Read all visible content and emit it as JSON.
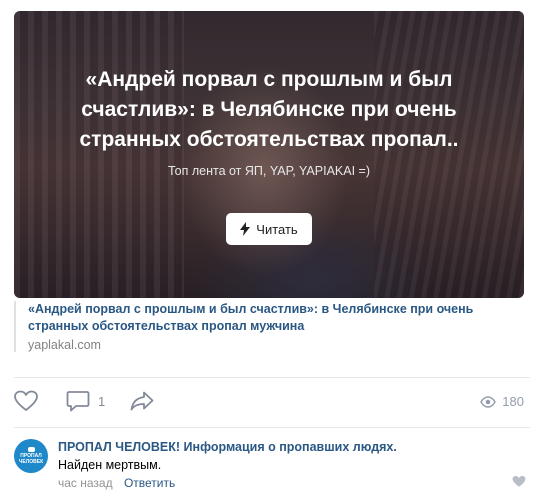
{
  "article": {
    "overlay_title": "«Андрей порвал с прошлым и был счастлив»: в Челябинске при очень странных обстоятельствах пропал..",
    "overlay_source": "Топ лента от ЯП, YAP, YAPIAKAI =)",
    "read_button_label": "Читать",
    "link_title": "«Андрей порвал с прошлым и был счастлив»: в Челябинске при очень странных обстоятельствах пропал мужчина",
    "domain": "yaplakal.com"
  },
  "actions": {
    "like_icon": "heart-icon",
    "comment_icon": "comment-icon",
    "comment_count": "1",
    "share_icon": "share-icon",
    "views_icon": "eye-icon",
    "views_count": "180"
  },
  "comment": {
    "avatar_text": "ПРОПАЛ ЧЕЛОВЕК",
    "author": "ПРОПАЛ ЧЕЛОВЕК! Информация о пропавших людях.",
    "text": "Найден мертвым.",
    "time": "час назад",
    "reply_label": "Ответить"
  },
  "colors": {
    "link": "#2a5885",
    "icon_gray": "#828a99",
    "meta_gray": "#939393",
    "avatar_blue": "#1e88c9"
  }
}
